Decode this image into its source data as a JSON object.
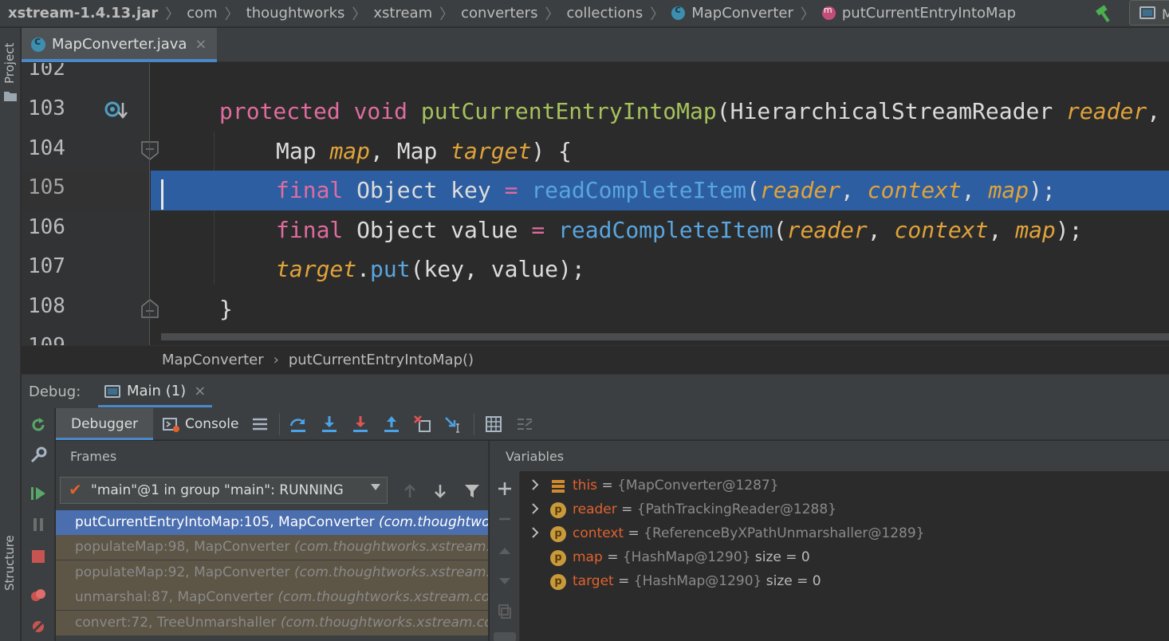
{
  "navbar": {
    "crumbs": [
      "xstream-1.4.13.jar",
      "com",
      "thoughtworks",
      "xstream",
      "converters",
      "collections",
      "MapConverter",
      "putCurrentEntryIntoMap"
    ],
    "run_config": "M"
  },
  "left_strip": {
    "project": "Project",
    "structure": "Structure"
  },
  "editor_tab": {
    "filename": "MapConverter.java",
    "close": "×"
  },
  "editor": {
    "lines": [
      {
        "num": "102",
        "text": ""
      },
      {
        "num": "103",
        "text": "protected void putCurrentEntryIntoMap(HierarchicalStreamReader reader,"
      },
      {
        "num": "104",
        "text": "Map map, Map target) {"
      },
      {
        "num": "105",
        "text": "final Object key = readCompleteItem(reader, context, map);"
      },
      {
        "num": "106",
        "text": "final Object value = readCompleteItem(reader, context, map);"
      },
      {
        "num": "107",
        "text": "target.put(key, value);"
      },
      {
        "num": "108",
        "text": "}"
      },
      {
        "num": "109",
        "text": ""
      }
    ],
    "current_line": "105"
  },
  "editor_breadcrumb": {
    "class": "MapConverter",
    "method": "putCurrentEntryIntoMap()"
  },
  "debug": {
    "label": "Debug:",
    "session": "Main (1)",
    "session_close": "×",
    "tabs": {
      "debugger": "Debugger",
      "console": "Console"
    }
  },
  "frames": {
    "title": "Frames",
    "thread": "\"main\"@1 in group \"main\": RUNNING",
    "rows": [
      {
        "method": "putCurrentEntryIntoMap:105, MapConverter",
        "pkg": "(com.thoughtworks.xstream.converters.collections)"
      },
      {
        "method": "populateMap:98, MapConverter",
        "pkg": "(com.thoughtworks.xstream.converters.collections)"
      },
      {
        "method": "populateMap:92, MapConverter",
        "pkg": "(com.thoughtworks.xstream.converters.collections)"
      },
      {
        "method": "unmarshal:87, MapConverter",
        "pkg": "(com.thoughtworks.xstream.converters.collections)"
      },
      {
        "method": "convert:72, TreeUnmarshaller",
        "pkg": "(com.thoughtworks.xstream.core)"
      }
    ]
  },
  "variables": {
    "title": "Variables",
    "items": [
      {
        "name": "this",
        "value": "{MapConverter@1287}",
        "size": "",
        "icon": "stack-icon",
        "expandable": true
      },
      {
        "name": "reader",
        "value": "{PathTrackingReader@1288}",
        "size": "",
        "icon": "p",
        "expandable": true
      },
      {
        "name": "context",
        "value": "{ReferenceByXPathUnmarshaller@1289}",
        "size": "",
        "icon": "p",
        "expandable": true
      },
      {
        "name": "map",
        "value": "{HashMap@1290}",
        "size": "size = 0",
        "icon": "p",
        "expandable": false
      },
      {
        "name": "target",
        "value": "{HashMap@1290}",
        "size": "size = 0",
        "icon": "p",
        "expandable": false
      }
    ],
    "eq": "="
  }
}
